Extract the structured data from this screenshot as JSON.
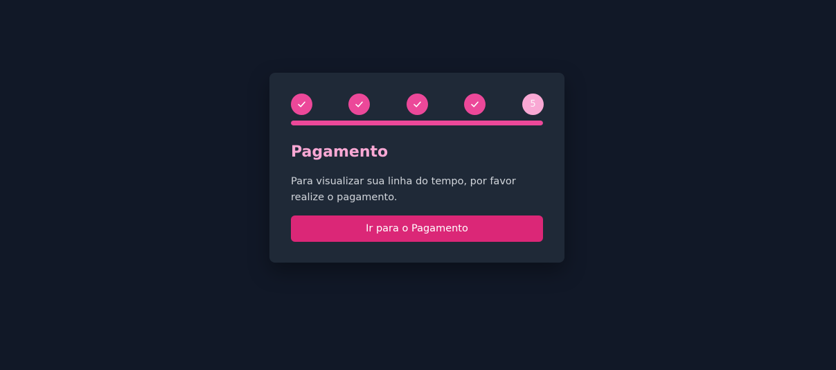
{
  "stepper": {
    "steps": [
      {
        "status": "completed",
        "icon": "check-icon",
        "label": ""
      },
      {
        "status": "completed",
        "icon": "check-icon",
        "label": ""
      },
      {
        "status": "completed",
        "icon": "check-icon",
        "label": ""
      },
      {
        "status": "completed",
        "icon": "check-icon",
        "label": ""
      },
      {
        "status": "current",
        "icon": "",
        "label": "5"
      }
    ],
    "progress_fraction": 1.0
  },
  "card": {
    "title": "Pagamento",
    "description": "Para visualizar sua linha do tempo, por favor realize o pagamento.",
    "button_label": "Ir para o Pagamento"
  },
  "colors": {
    "background": "#111827",
    "card": "#1f2937",
    "accent": "#ec4899",
    "accent_light": "#f9a8d4",
    "button": "#db2777"
  }
}
